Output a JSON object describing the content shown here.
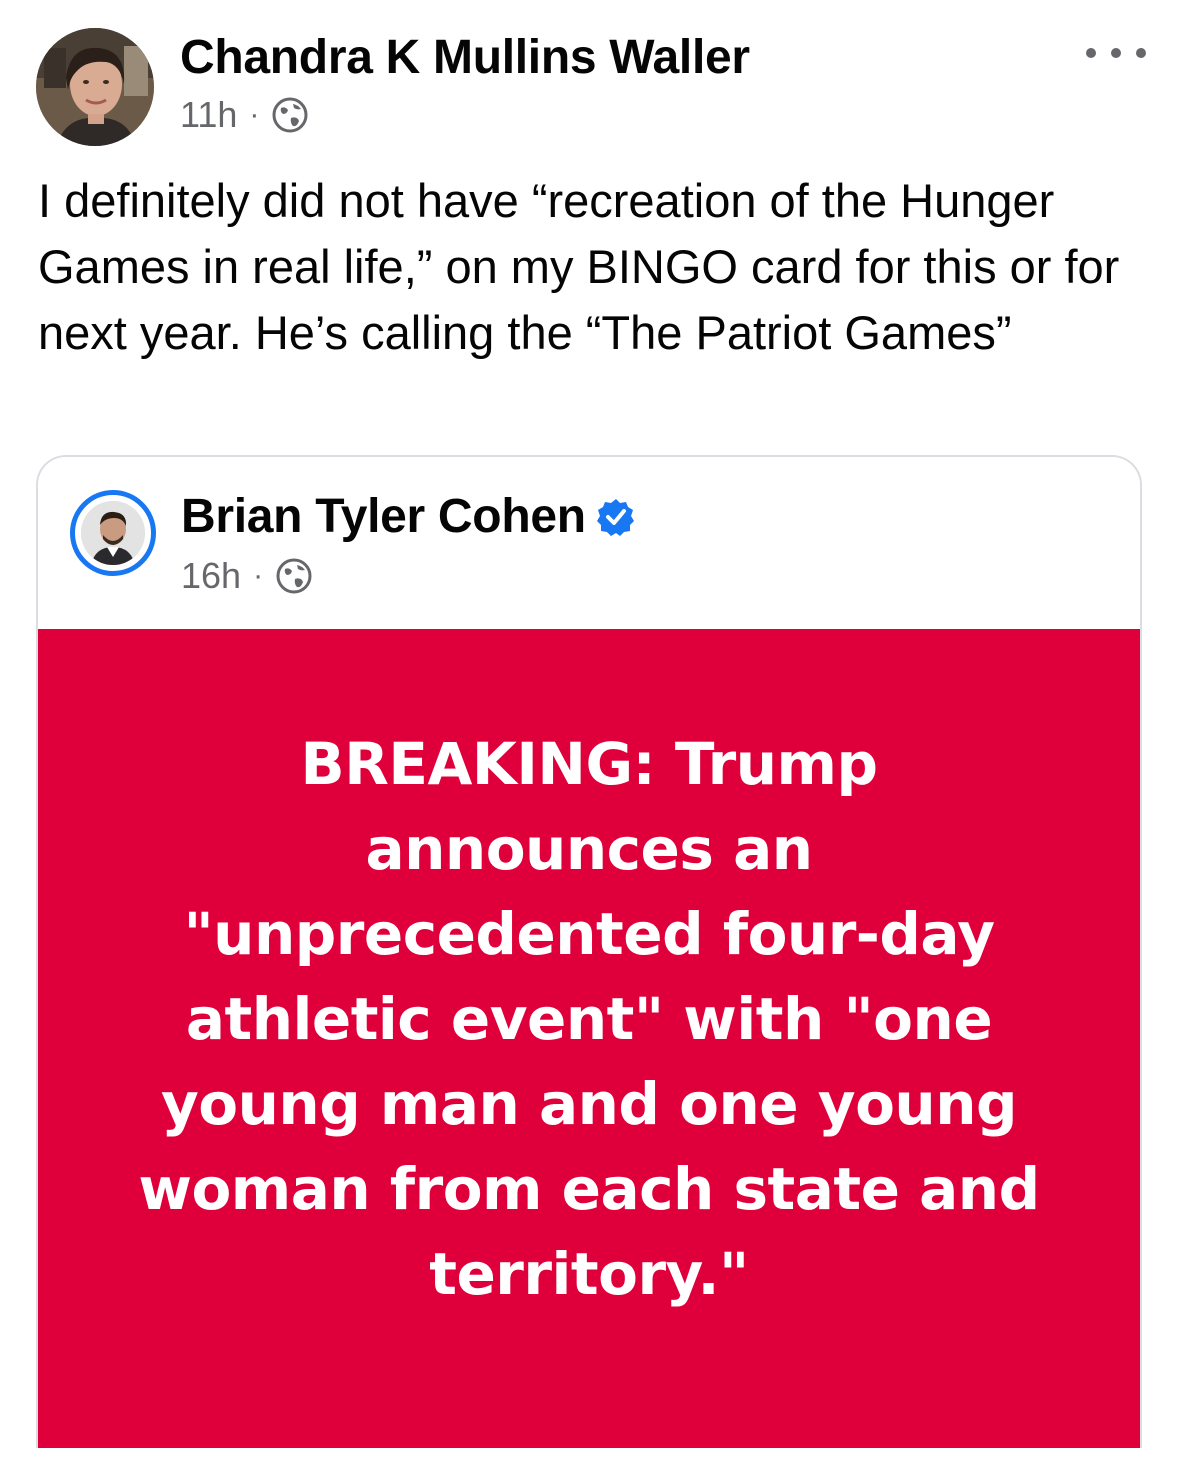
{
  "post": {
    "author": "Chandra K Mullins Waller",
    "time": "11h",
    "separator": "·",
    "audience_icon": "globe-icon",
    "text": "I definitely did not have “recreation of the Hunger Games in real life,” on my BINGO card for this or for next year. He’s calling the “The Patriot Games”"
  },
  "shared_post": {
    "author": "Brian Tyler Cohen",
    "verified": true,
    "time": "16h",
    "separator": "·",
    "audience_icon": "globe-icon",
    "headline": "BREAKING: Trump announces an \"unprecedented four-day athletic event\" with \"one young man and one young woman from each state and territory.\""
  },
  "colors": {
    "breaking_background": "#df003b",
    "verified_badge": "#1877f2",
    "meta_text": "#65676b"
  }
}
